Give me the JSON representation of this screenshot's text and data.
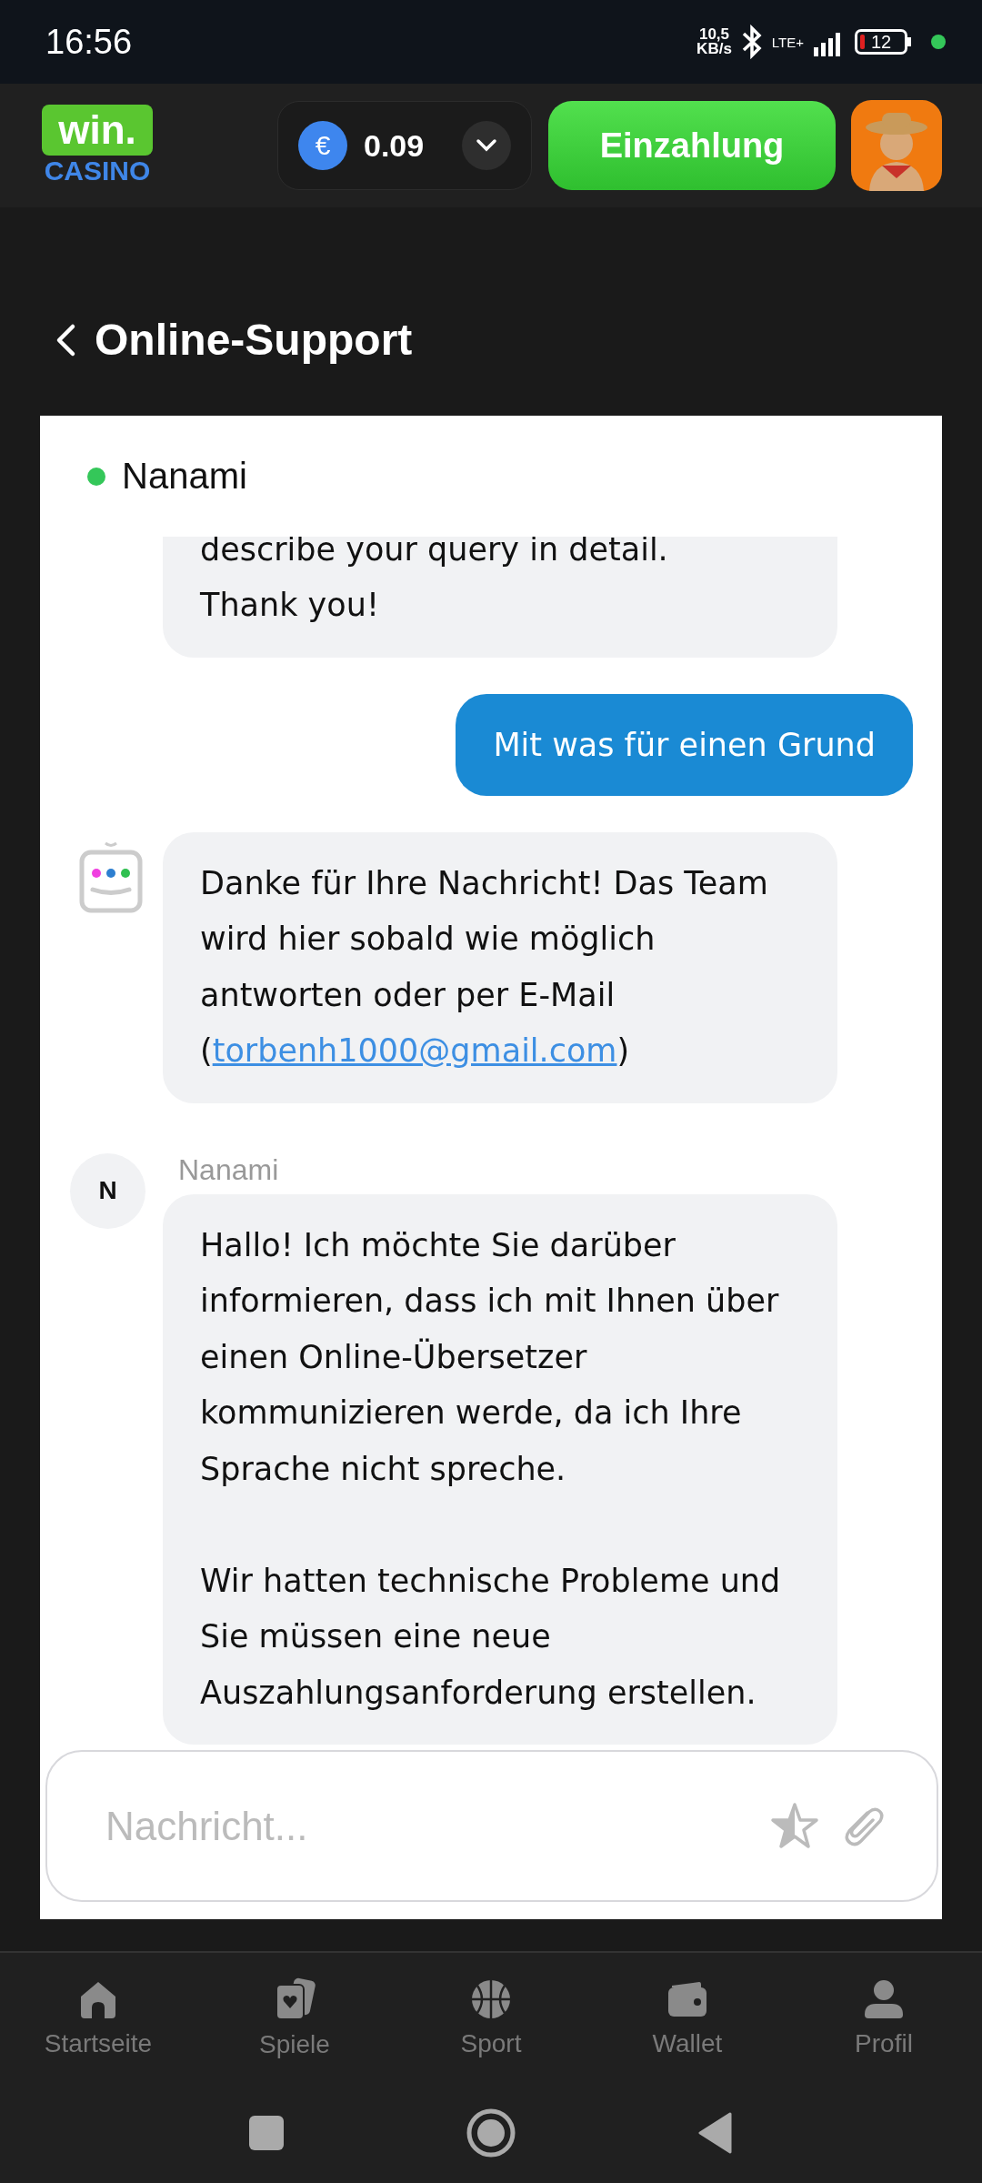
{
  "status_bar": {
    "time": "16:56",
    "net_speed_value": "10,5",
    "net_speed_unit": "KB/s",
    "network": "LTE+",
    "battery": "12"
  },
  "header": {
    "logo_word": "win.",
    "logo_sub": "CASINO",
    "currency_symbol": "€",
    "balance": "0.09",
    "deposit_button": "Einzahlung"
  },
  "page_title": "Online-Support",
  "chat": {
    "agent_name": "Nanami",
    "online": true,
    "messages": [
      {
        "kind": "incoming",
        "paragraphs": [
          "describe your query in detail.\nThank you!"
        ]
      },
      {
        "kind": "outgoing",
        "paragraphs": [
          "Mit was für einen Grund"
        ]
      },
      {
        "kind": "bot",
        "text_before": "Danke für Ihre Nachricht! Das Team wird hier sobald wie möglich antworten oder per E-Mail (",
        "link": "torbenh1000@gmail.com",
        "text_after": ")"
      },
      {
        "kind": "agent",
        "sender": "Nanami",
        "initial": "N",
        "paragraphs": [
          "Hallo! Ich möchte Sie darüber informieren, dass ich mit Ihnen über einen Online-Übersetzer kommunizieren werde, da ich Ihre Sprache nicht spreche.",
          "Wir hatten technische Probleme und Sie müssen eine neue Auszahlungsanforderung erstellen."
        ]
      }
    ],
    "input": {
      "placeholder": "Nachricht..."
    }
  },
  "bottom_nav": [
    {
      "kind": "home",
      "label": "Startseite",
      "selected": false
    },
    {
      "kind": "games",
      "label": "Spiele",
      "selected": false
    },
    {
      "kind": "sport",
      "label": "Sport",
      "selected": false
    },
    {
      "kind": "wallet",
      "label": "Wallet",
      "selected": false
    },
    {
      "kind": "profile",
      "label": "Profil",
      "selected": false
    }
  ]
}
